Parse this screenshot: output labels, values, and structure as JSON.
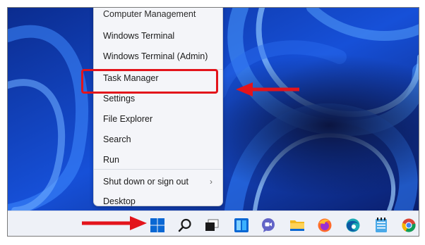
{
  "context_menu": {
    "clipped_top_item": "Computer Management",
    "items": [
      {
        "label": "Windows Terminal"
      },
      {
        "label": "Windows Terminal (Admin)"
      },
      {
        "label": "Task Manager"
      },
      {
        "label": "Settings"
      },
      {
        "label": "File Explorer"
      },
      {
        "label": "Search"
      },
      {
        "label": "Run"
      },
      {
        "label": "Shut down or sign out"
      },
      {
        "label": "Desktop"
      }
    ],
    "highlighted_item": "Settings",
    "submenu_chevron": "›"
  },
  "taskbar": {
    "icons": [
      "windows-start-icon",
      "search-icon",
      "task-view-icon",
      "widgets-icon",
      "teams-chat-icon",
      "file-explorer-icon",
      "firefox-icon",
      "edge-icon",
      "notepad-icon",
      "chrome-icon"
    ]
  },
  "colors": {
    "annotation_red": "#e3141b",
    "wallpaper_blue": "#1246c8",
    "menu_background": "#f4f5f9",
    "taskbar_background": "#eef1f7",
    "start_blue": "#0a67d3"
  }
}
